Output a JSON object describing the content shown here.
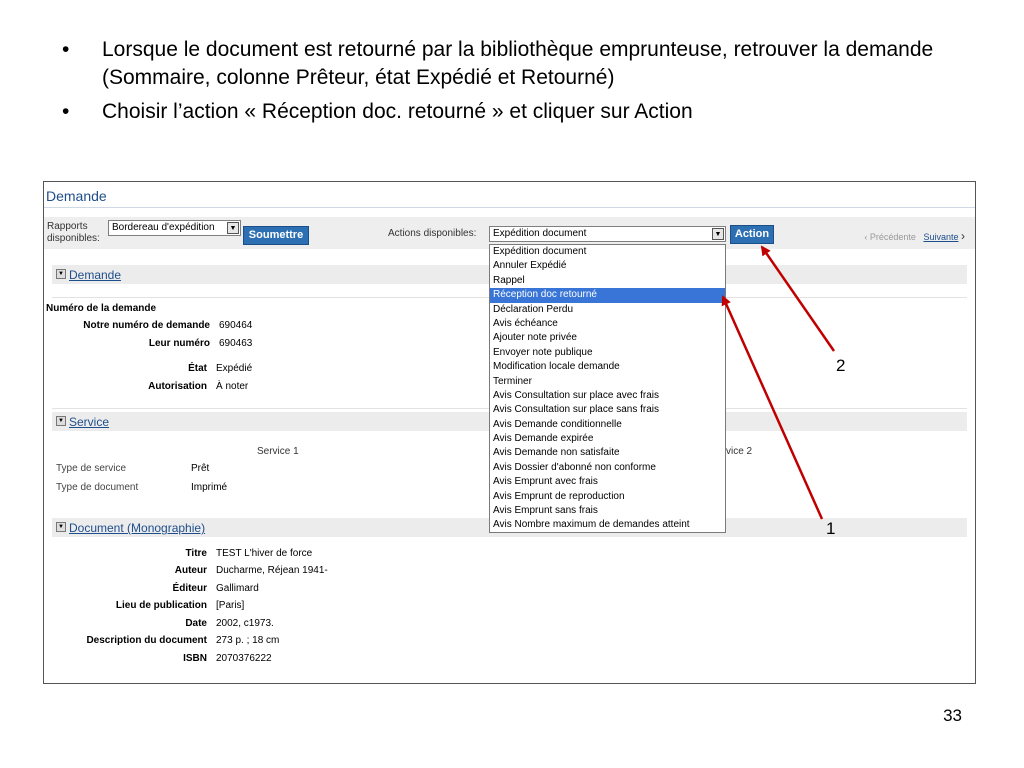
{
  "bullets": [
    {
      "symbol": "•",
      "text": "Lorsque le document est retourné par la bibliothèque emprunteuse, retrouver la demande (Sommaire, colonne Prêteur, état Expédié et Retourné)"
    },
    {
      "symbol": "•",
      "text": "Choisir l’action « Réception doc. retourné » et cliquer sur Action"
    }
  ],
  "screenshot": {
    "title": "Demande",
    "toolbar": {
      "reports_label": "Rapports disponibles:",
      "reports_value": "Bordereau d'expédition",
      "submit_label": "Soumettre",
      "actions_label": "Actions disponibles:",
      "actions_value": "Expédition document",
      "action_button": "Action",
      "prev_label": "Précédente",
      "next_label": "Suivante",
      "prev_chev": "‹",
      "next_chev": "›"
    },
    "dropdown_options": [
      "Expédition document",
      "Annuler Expédié",
      "Rappel",
      "Réception doc retourné",
      "Déclaration Perdu",
      "Avis échéance",
      "Ajouter note privée",
      "Envoyer note publique",
      "Modification locale demande",
      "Terminer",
      "Avis Consultation sur place avec frais",
      "Avis Consultation sur place sans frais",
      "Avis Demande conditionnelle",
      "Avis Demande expirée",
      "Avis Demande non satisfaite",
      "Avis Dossier d'abonné non conforme",
      "Avis Emprunt avec frais",
      "Avis Emprunt de reproduction",
      "Avis Emprunt sans frais",
      "Avis Nombre maximum de demandes atteint"
    ],
    "selected_option": "Réception doc retourné",
    "demande_section": {
      "heading": "Demande",
      "subheading": "Numéro de la demande",
      "fields": [
        {
          "label": "Notre numéro de demande",
          "value": "690464"
        },
        {
          "label": "Leur numéro",
          "value": "690463"
        },
        {
          "label": "État",
          "value": "Expédié"
        },
        {
          "label": "Autorisation",
          "value": "À noter"
        }
      ]
    },
    "service_section": {
      "heading": "Service",
      "col1": "Service 1",
      "col2_partial": "vice 2",
      "rows": [
        {
          "label": "Type de service",
          "value": "Prêt"
        },
        {
          "label": "Type de document",
          "value": "Imprimé"
        }
      ]
    },
    "document_section": {
      "heading": "Document (Monographie)",
      "fields": [
        {
          "label": "Titre",
          "value": "TEST L'hiver de force"
        },
        {
          "label": "Auteur",
          "value": "Ducharme, Réjean 1941-"
        },
        {
          "label": "Éditeur",
          "value": "Gallimard"
        },
        {
          "label": "Lieu de publication",
          "value": "[Paris]"
        },
        {
          "label": "Date",
          "value": "2002, c1973."
        },
        {
          "label": "Description du document",
          "value": "273 p. ; 18 cm"
        },
        {
          "label": "ISBN",
          "value": "2070376222"
        }
      ]
    }
  },
  "annotations": {
    "arrow1": "1",
    "arrow2": "2",
    "arrow_color": "#c00000"
  },
  "slide_number": "33"
}
